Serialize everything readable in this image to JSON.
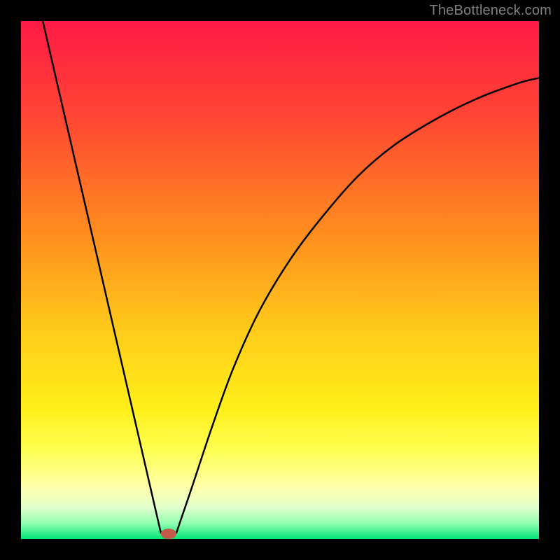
{
  "attribution": "TheBottleneck.com",
  "chart_data": {
    "type": "line",
    "title": "",
    "xlabel": "",
    "ylabel": "",
    "xlim": [
      0,
      1
    ],
    "ylim": [
      0,
      1
    ],
    "gradient_stops": [
      {
        "offset": 0.0,
        "color": "#ff1a46"
      },
      {
        "offset": 0.18,
        "color": "#ff4433"
      },
      {
        "offset": 0.4,
        "color": "#ff8a1f"
      },
      {
        "offset": 0.6,
        "color": "#ffcc1a"
      },
      {
        "offset": 0.75,
        "color": "#fff01a"
      },
      {
        "offset": 0.83,
        "color": "#ffff55"
      },
      {
        "offset": 0.9,
        "color": "#ffffaa"
      },
      {
        "offset": 0.94,
        "color": "#e0ffcc"
      },
      {
        "offset": 0.97,
        "color": "#90ffb0"
      },
      {
        "offset": 1.0,
        "color": "#00e676"
      }
    ],
    "series": [
      {
        "name": "left-branch",
        "x": [
          0.042,
          0.27
        ],
        "y": [
          1.0,
          0.012
        ]
      },
      {
        "name": "right-branch",
        "x": [
          0.3,
          0.33,
          0.37,
          0.41,
          0.46,
          0.52,
          0.58,
          0.65,
          0.72,
          0.8,
          0.88,
          0.96,
          1.0
        ],
        "y": [
          0.012,
          0.1,
          0.22,
          0.33,
          0.44,
          0.54,
          0.62,
          0.7,
          0.76,
          0.81,
          0.85,
          0.88,
          0.89
        ]
      }
    ],
    "marker": {
      "name": "minimum-marker",
      "x": 0.285,
      "y": 0.01,
      "rx": 0.015,
      "ry": 0.01,
      "color": "#c45a4a"
    }
  }
}
